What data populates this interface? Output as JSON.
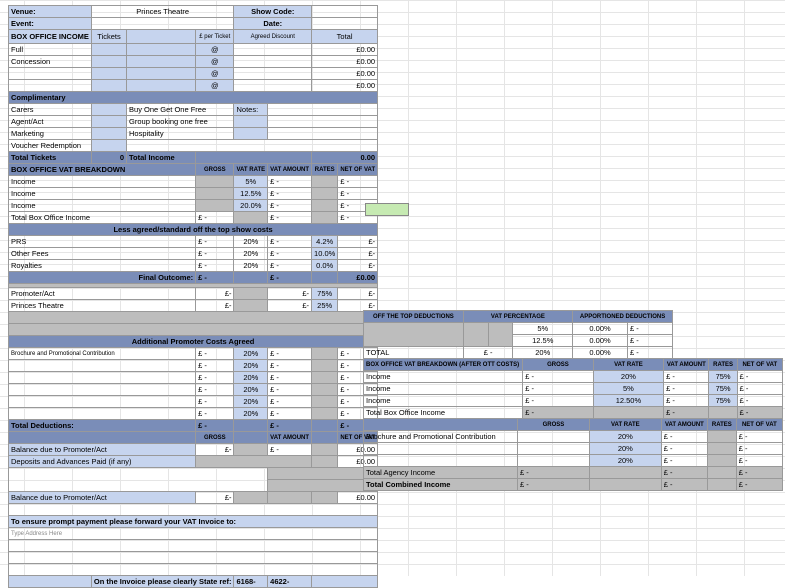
{
  "top": {
    "venue_lbl": "Venue:",
    "venue_val": "Princes Theatre",
    "showcode_lbl": "Show Code:",
    "event_lbl": "Event:",
    "date_lbl": "Date:",
    "boi_title": "BOX OFFICE INCOME",
    "tickets_lbl": "Tickets",
    "per_ticket_lbl": "£ per Ticket",
    "agreed_discount_lbl": "Agreed Discount",
    "total_lbl": "Total"
  },
  "boi_rows": [
    "Full",
    "Concession",
    "",
    ""
  ],
  "boi_at": "@",
  "boi_zero": "£0.00",
  "comp": {
    "title": "Complimentary",
    "carers_lbl": "Carers",
    "carers_note": "Buy One Get One Free",
    "notes_lbl": "Notes:",
    "agent_lbl": "Agent/Act",
    "agent_note": "Group booking one free",
    "marketing_lbl": "Marketing",
    "marketing_note": "Hospitality",
    "voucher_lbl": "Voucher Redemption",
    "total_tickets_lbl": "Total Tickets",
    "total_tickets_n": "0",
    "total_income_lbl": "Total Income",
    "total_income_val": "0.00"
  },
  "vatb": {
    "title": "BOX OFFICE VAT BREAKDOWN",
    "gross": "GROSS",
    "vatrate": "VAT RATE",
    "vatamt": "VAT AMOUNT",
    "rates": "RATES",
    "netvat": "NET OF VAT",
    "rows": [
      {
        "lbl": "Income",
        "rate": "5%"
      },
      {
        "lbl": "Income",
        "rate": "12.5%"
      },
      {
        "lbl": "Income",
        "rate": "20.0%"
      }
    ],
    "totalrow": "Total Box Office Income",
    "pound_dash": "£   -",
    "e_dash": "£-"
  },
  "less": {
    "title": "Less agreed/standard off the top show costs",
    "rows": [
      {
        "lbl": "PRS",
        "rate": "20%",
        "pct": "4.2%"
      },
      {
        "lbl": "Other Fees",
        "rate": "20%",
        "pct": "10.0%"
      },
      {
        "lbl": "Royalties",
        "rate": "20%",
        "pct": "0.0%"
      }
    ],
    "final_lbl": "Final Outcome:",
    "final_val": "£0.00",
    "split": [
      {
        "lbl": "Promoter/Act",
        "pct": "75%"
      },
      {
        "lbl": "Princes Theatre",
        "pct": "25%"
      }
    ]
  },
  "apc": {
    "title": "Additional Promoter Costs Agreed",
    "row1": "Brochure and Promotional Contribution",
    "rate": "20%",
    "total_ded_lbl": "Total Deductions:",
    "gross": "GROSS",
    "vatamt": "VAT AMOUNT",
    "netvat": "NET OF VAT",
    "bal1": "Balance due to Promoter/Act",
    "dep": "Deposits and Advances Paid (if any)",
    "bal2": "Balance due to Promoter/Act",
    "edash": "£-",
    "zero": "£0.00"
  },
  "footer": {
    "line": "To ensure prompt payment please forward your VAT Invoice to:",
    "addr": "Type Address Here",
    "invref_lbl": "On the Invoice please clearly State ref:",
    "ref1": "6168-",
    "ref2": "4622-"
  },
  "right_top": {
    "c1": "OFF THE TOP DEDUCTIONS",
    "c2": "VAT PERCENTAGE",
    "c3": "APPORTIONED DEDUCTIONS",
    "rows": [
      {
        "p": "5%",
        "v": "0.00%"
      },
      {
        "p": "12.5%",
        "v": "0.00%"
      },
      {
        "p": "20%",
        "v": "0.00%"
      }
    ],
    "total": "TOTAL",
    "eblank": "£   -",
    "edash": "£   -"
  },
  "right_vatb": {
    "title": "BOX OFFICE VAT BREAKDOWN (AFTER OTT COSTS)",
    "gross": "GROSS",
    "vatrate": "VAT RATE",
    "vatamt": "VAT AMOUNT",
    "rates": "RATES",
    "netvat": "NET OF VAT",
    "rows": [
      {
        "lbl": "Income",
        "rate": "20%",
        "r": "75%"
      },
      {
        "lbl": "Income",
        "rate": "5%",
        "r": "75%"
      },
      {
        "lbl": "Income",
        "rate": "12.50%",
        "r": "75%"
      }
    ],
    "total": "Total Box Office Income",
    "pound_dash": "£   -",
    "edash": "£   -"
  },
  "right_bot": {
    "gross": "GROSS",
    "vatrate": "VAT RATE",
    "vatamt": "VAT AMOUNT",
    "rates": "RATES",
    "netvat": "NET OF VAT",
    "row1": "Brochure and Promotional Contribution",
    "rate": "20%",
    "tai": "Total Agency Income",
    "tci": "Total Combined Income",
    "pound_dash": "£   -",
    "edash": "£   -"
  }
}
